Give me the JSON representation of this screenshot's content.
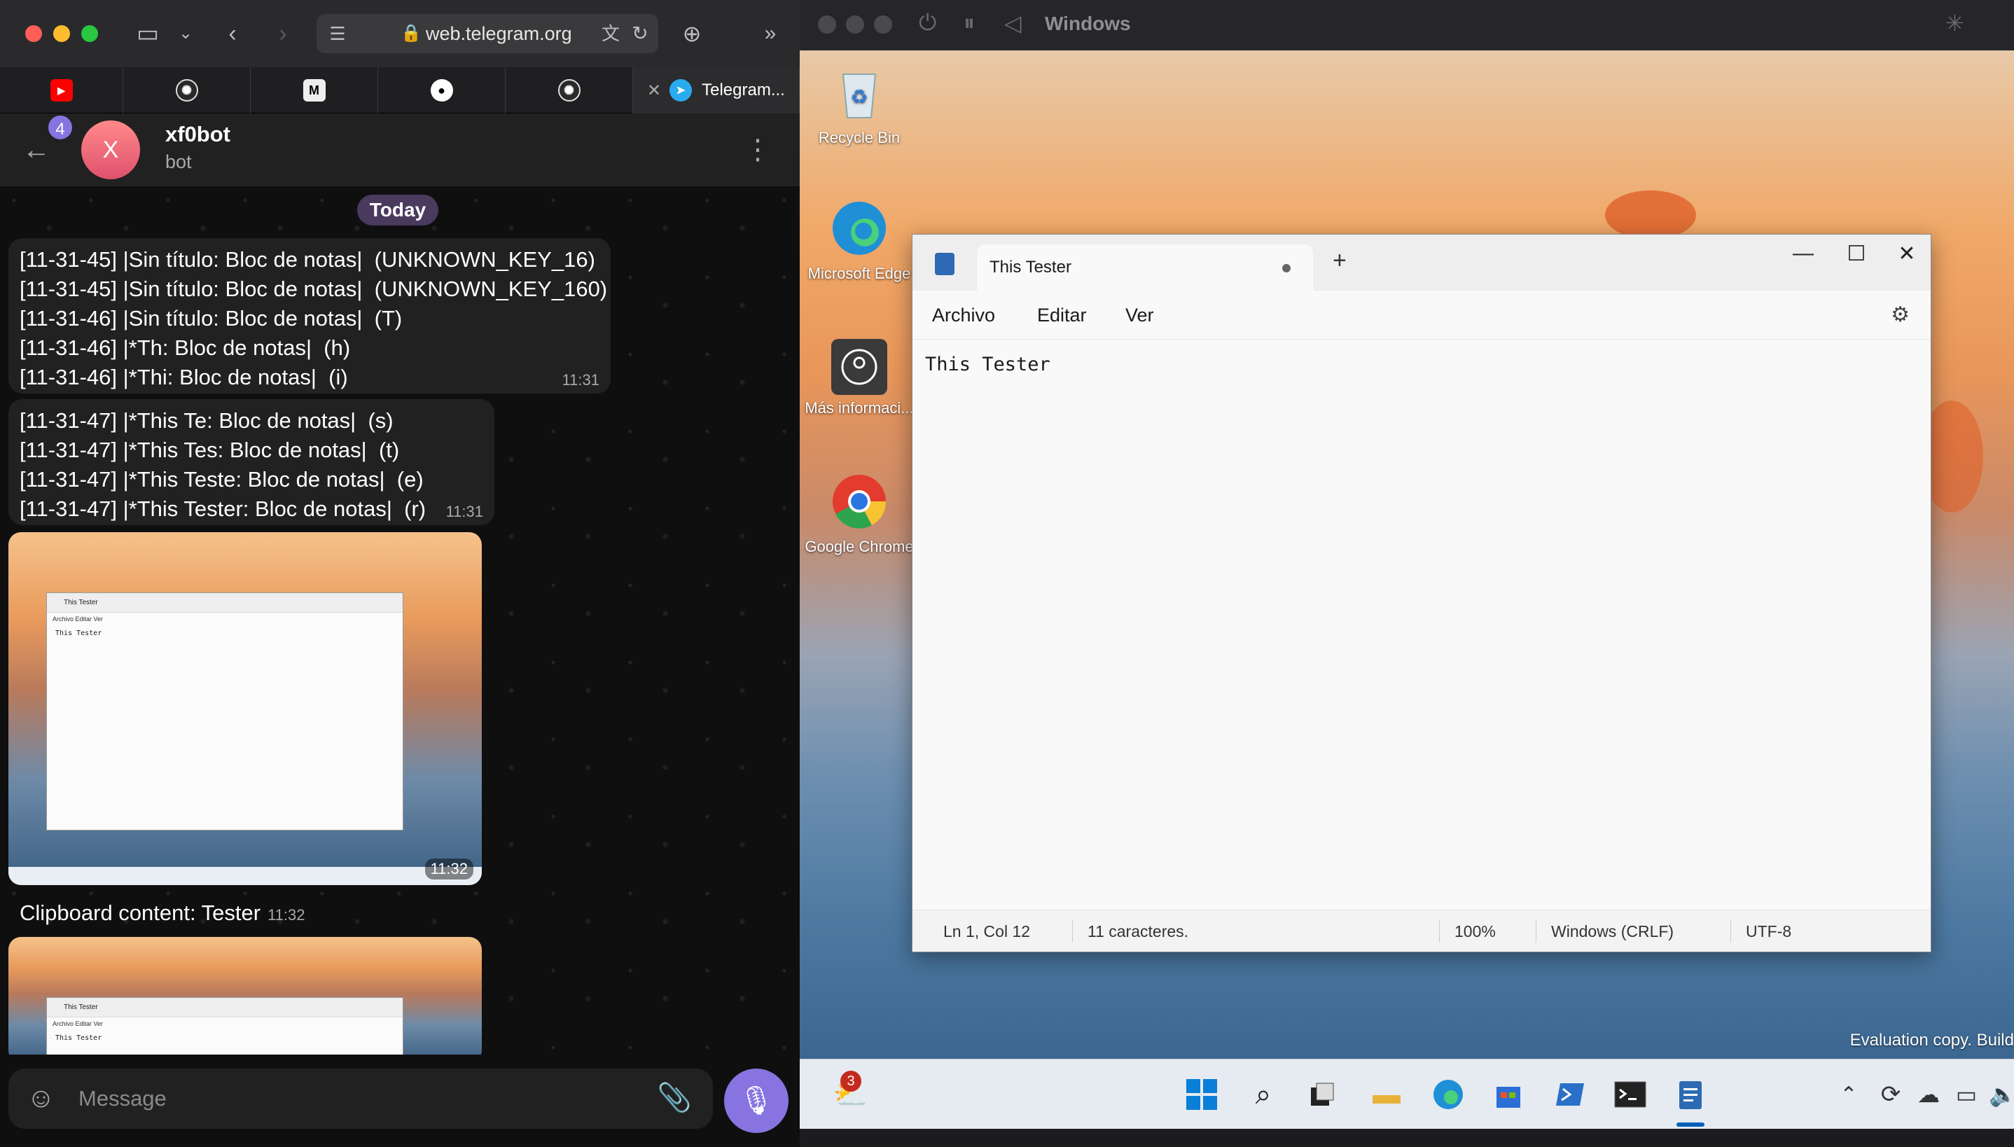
{
  "browser": {
    "url": "web.telegram.org",
    "tabs": [
      {
        "icon": "youtube-icon"
      },
      {
        "icon": "openai-icon"
      },
      {
        "icon": "medium-icon"
      },
      {
        "icon": "github-icon"
      },
      {
        "icon": "openai-icon"
      },
      {
        "icon": "telegram-icon",
        "title": "Telegram..."
      }
    ]
  },
  "chat": {
    "unread_count": "4",
    "avatar_letter": "X",
    "name": "xf0bot",
    "status": "bot",
    "date_separator": "Today",
    "messages": [
      {
        "lines": [
          "[11-31-45] |Sin título: Bloc de notas|  (UNKNOWN_KEY_16)",
          "[11-31-45] |Sin título: Bloc de notas|  (UNKNOWN_KEY_160)",
          "[11-31-46] |Sin título: Bloc de notas|  (T)",
          "[11-31-46] |*Th: Bloc de notas|  (h)",
          "[11-31-46] |*Thi: Bloc de notas|  (i)"
        ],
        "time": "11:31"
      },
      {
        "lines": [
          "[11-31-47] |*This Te: Bloc de notas|  (s)",
          "[11-31-47] |*This Tes: Bloc de notas|  (t)",
          "[11-31-47] |*This Teste: Bloc de notas|  (e)",
          "[11-31-47] |*This Tester: Bloc de notas|  (r)"
        ],
        "time": "11:31"
      }
    ],
    "photo_time": "11:32",
    "photo_window_title": "This Tester",
    "photo_menu": "Archivo   Editar   Ver",
    "photo_text": "This Tester",
    "clipboard_text": "Clipboard content: Tester",
    "clipboard_time": "11:32",
    "composer_placeholder": "Message"
  },
  "vm": {
    "title": "Windows",
    "desktop_icons": [
      {
        "label": "Recycle Bin",
        "icon": "recycle-bin-icon"
      },
      {
        "label": "Microsoft Edge",
        "icon": "edge-icon"
      },
      {
        "label": "Más informaci...",
        "icon": "info-icon"
      },
      {
        "label": "Google Chrome",
        "icon": "chrome-icon"
      }
    ],
    "notepad": {
      "tab_title": "This Tester",
      "menu": [
        "Archivo",
        "Editar",
        "Ver"
      ],
      "content": "This Tester",
      "status": {
        "position": "Ln 1, Col 12",
        "chars": "11 caracteres.",
        "zoom": "100%",
        "line_ending": "Windows (CRLF)",
        "encoding": "UTF-8"
      }
    },
    "watermark": "Evaluation copy. Build",
    "weather_badge": "3"
  },
  "colors": {
    "telegram_accent": "#8774e1",
    "windows_accent": "#005fb8"
  }
}
